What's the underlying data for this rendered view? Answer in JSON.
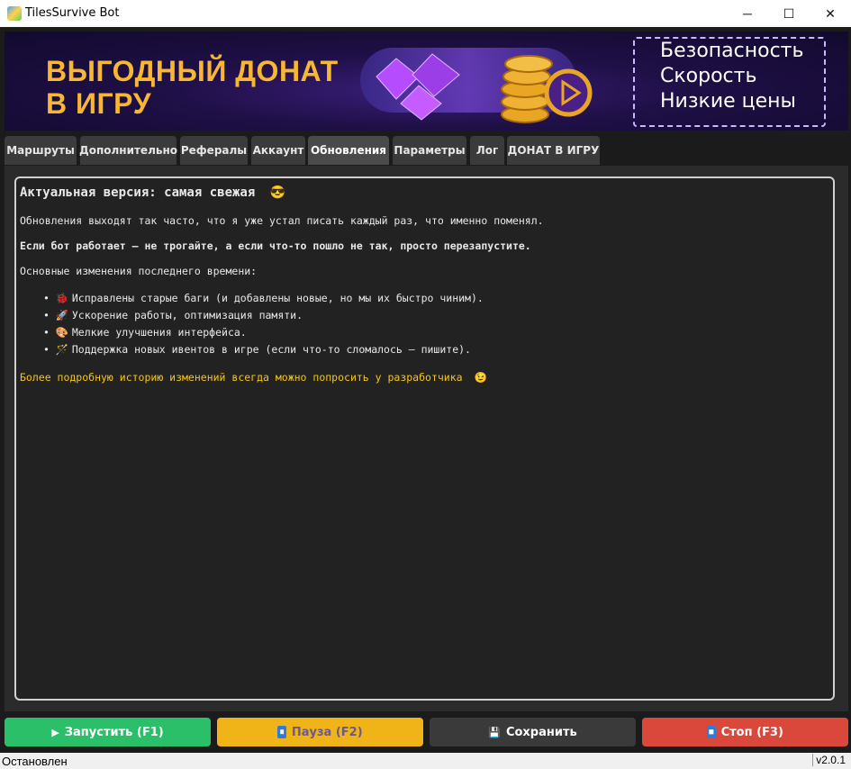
{
  "window": {
    "title": "TilesSurvive Bot",
    "minimize": "─",
    "maximize": "☐",
    "close": "✕"
  },
  "banner": {
    "left_line1": "ВЫГОДНЫЙ ДОНАТ",
    "left_line2": "В ИГРУ",
    "right_lines": [
      "Безопасность",
      "Скорость",
      "Низкие цены"
    ]
  },
  "tabs": [
    {
      "label": "Маршруты",
      "active": false
    },
    {
      "label": "Дополнительно",
      "active": false
    },
    {
      "label": "Рефералы",
      "active": false
    },
    {
      "label": "Аккаунт",
      "active": false
    },
    {
      "label": "Обновления",
      "active": true
    },
    {
      "label": "Параметры",
      "active": false
    },
    {
      "label": "Лог",
      "active": false
    },
    {
      "label": "ДОНАТ В ИГРУ",
      "active": false
    }
  ],
  "updates": {
    "heading": "Актуальная версия: самая свежая",
    "heading_emoji": "😎",
    "p1": "Обновления выходят так часто, что я уже устал писать каждый раз, что именно поменял.",
    "p2": "Если бот работает – не трогайте, а если что-то пошло не так, просто перезапустите.",
    "p3": "Основные изменения последнего времени:",
    "items": [
      {
        "icon": "🐞",
        "text": "Исправлены старые баги (и добавлены новые, но мы их быстро чиним)."
      },
      {
        "icon": "🚀",
        "text": "Ускорение работы, оптимизация памяти."
      },
      {
        "icon": "🎨",
        "text": "Мелкие улучшения интерфейса."
      },
      {
        "icon": "🪄",
        "text": "Поддержка новых ивентов в игре (если что-то сломалось – пишите)."
      }
    ],
    "footer": "Более подробную историю изменений всегда можно попросить у разработчика",
    "footer_emoji": "😉"
  },
  "buttons": {
    "start": "Запустить (F1)",
    "start_icon": "▶",
    "pause": "Пауза (F2)",
    "pause_icon": "⏸",
    "save": "Сохранить",
    "save_icon": "💾",
    "stop": "Стоп (F3)",
    "stop_icon": "⏹"
  },
  "colors": {
    "start": "#2bbf6a",
    "pause": "#f0b419",
    "save": "#3a3a3a",
    "stop": "#d9483b",
    "accent_yellow": "#f5c518"
  },
  "status": {
    "text": "Остановлен",
    "version": "v2.0.1"
  }
}
